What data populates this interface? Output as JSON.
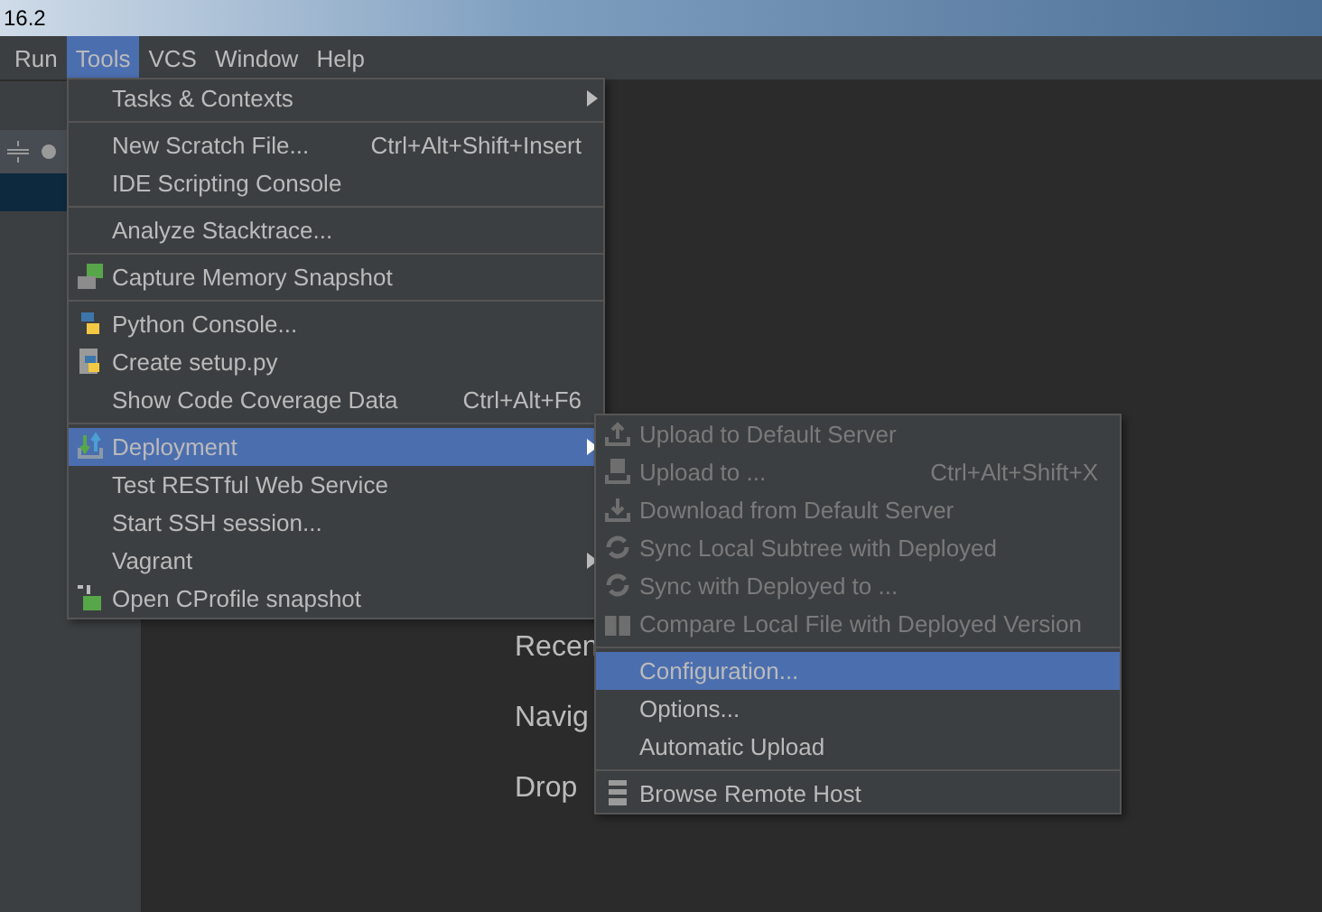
{
  "window": {
    "title": "16.2"
  },
  "menu_bar": [
    {
      "label": "Run",
      "selected": false
    },
    {
      "label": "Tools",
      "selected": true
    },
    {
      "label": "VCS",
      "selected": false
    },
    {
      "label": "Window",
      "selected": false
    },
    {
      "label": "Help",
      "selected": false
    }
  ],
  "welcome": [
    "Recen",
    "Navig",
    "Drop"
  ],
  "tools_menu": [
    [
      {
        "label": "Tasks & Contexts",
        "submenu": true,
        "selected": false
      }
    ],
    [
      {
        "label": "New Scratch File...",
        "shortcut": "Ctrl+Alt+Shift+Insert",
        "selected": false
      },
      {
        "label": "IDE Scripting Console",
        "selected": false
      }
    ],
    [
      {
        "label": "Analyze Stacktrace...",
        "selected": false
      }
    ],
    [
      {
        "label": "Capture Memory Snapshot",
        "selected": false
      }
    ],
    [
      {
        "label": "Python Console...",
        "selected": false
      },
      {
        "label": "Create setup.py",
        "selected": false
      },
      {
        "label": "Show Code Coverage Data",
        "shortcut": "Ctrl+Alt+F6",
        "selected": false
      }
    ],
    [
      {
        "label": "Deployment",
        "submenu": true,
        "selected": true
      },
      {
        "label": "Test RESTful Web Service",
        "selected": false
      },
      {
        "label": "Start SSH session...",
        "selected": false
      },
      {
        "label": "Vagrant",
        "submenu": true,
        "selected": false
      },
      {
        "label": "Open CProfile snapshot",
        "selected": false
      }
    ]
  ],
  "deployment_menu": [
    [
      {
        "label": "Upload to Default Server",
        "disabled": true,
        "selected": false
      },
      {
        "label": "Upload to ...",
        "shortcut": "Ctrl+Alt+Shift+X",
        "disabled": true,
        "selected": false
      },
      {
        "label": "Download from Default Server",
        "disabled": true,
        "selected": false
      },
      {
        "label": "Sync Local Subtree with Deployed",
        "disabled": true,
        "selected": false
      },
      {
        "label": "Sync with Deployed to ...",
        "disabled": true,
        "selected": false
      },
      {
        "label": "Compare Local File with Deployed Version",
        "disabled": true,
        "selected": false
      }
    ],
    [
      {
        "label": "Configuration...",
        "disabled": false,
        "selected": true
      },
      {
        "label": "Options...",
        "disabled": false,
        "selected": false
      },
      {
        "label": "Automatic Upload",
        "disabled": false,
        "selected": false
      }
    ],
    [
      {
        "label": "Browse Remote Host",
        "disabled": false,
        "selected": false
      }
    ]
  ]
}
